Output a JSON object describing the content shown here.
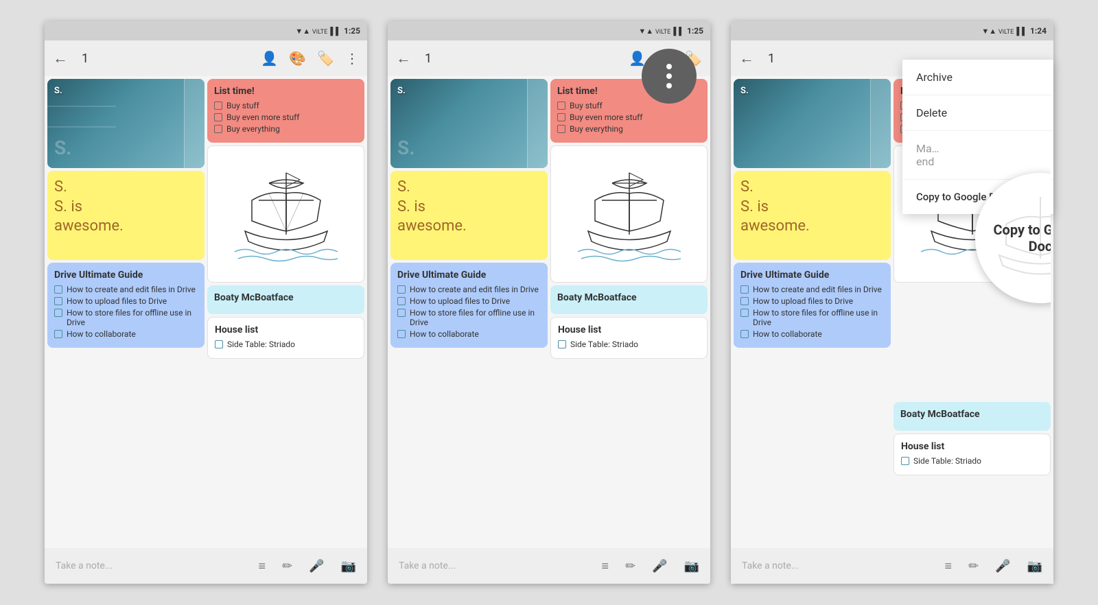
{
  "screens": [
    {
      "id": "screen1",
      "statusBar": {
        "time": "1:25",
        "signal": "▼▲",
        "wifi": "WiFi",
        "battery": "🔋"
      },
      "toolbar": {
        "back": "←",
        "number": "1",
        "icons": [
          "👤",
          "🎨",
          "🏷️",
          "⋮"
        ]
      },
      "notes": {
        "col1": [
          {
            "type": "image",
            "label": "book-cover-note"
          },
          {
            "type": "yellow",
            "letter": "S.",
            "body": "S. is\nawesome.",
            "label": "yellow-note"
          },
          {
            "type": "teal",
            "title": "Drive Ultimate Guide",
            "items": [
              "How to create and edit files in Drive",
              "How to upload files to Drive",
              "How to store files for offline use in Drive",
              "How to collaborate"
            ],
            "label": "drive-guide-note"
          }
        ],
        "col2": [
          {
            "type": "pink",
            "title": "List time!",
            "items": [
              "Buy stuff",
              "Buy even more stuff",
              "Buy everything"
            ],
            "label": "list-time-note"
          },
          {
            "type": "ship",
            "label": "ship-drawing-note"
          },
          {
            "type": "blue",
            "title": "Boaty McBoatface",
            "label": "boaty-note"
          },
          {
            "type": "white",
            "title": "House list",
            "items": [
              "Side Table: Striado"
            ],
            "label": "house-list-note"
          }
        ]
      },
      "bottomBar": {
        "placeholder": "Take a note...",
        "icons": [
          "≡",
          "✏",
          "🎤",
          "📷"
        ]
      }
    },
    {
      "id": "screen2",
      "statusBar": {
        "time": "1:25"
      },
      "toolbar": {
        "back": "←",
        "number": "1",
        "icons": [
          "👤",
          "🎨",
          "🏷️"
        ]
      },
      "dotsButton": true,
      "bottomBar": {
        "placeholder": "Take a note...",
        "icons": [
          "≡",
          "✏",
          "🎤",
          "📷"
        ]
      }
    },
    {
      "id": "screen3",
      "statusBar": {
        "time": "1:24"
      },
      "toolbar": {
        "back": "←",
        "number": "1"
      },
      "dropdownMenu": {
        "items": [
          "Archive",
          "Delete",
          "Ma…\nend",
          "Copy to Google Doc"
        ]
      },
      "zoomLabel": "Copy to Google Doc",
      "bottomBar": {
        "placeholder": "Take a note...",
        "icons": [
          "≡",
          "✏",
          "🎤",
          "📷"
        ]
      }
    }
  ]
}
